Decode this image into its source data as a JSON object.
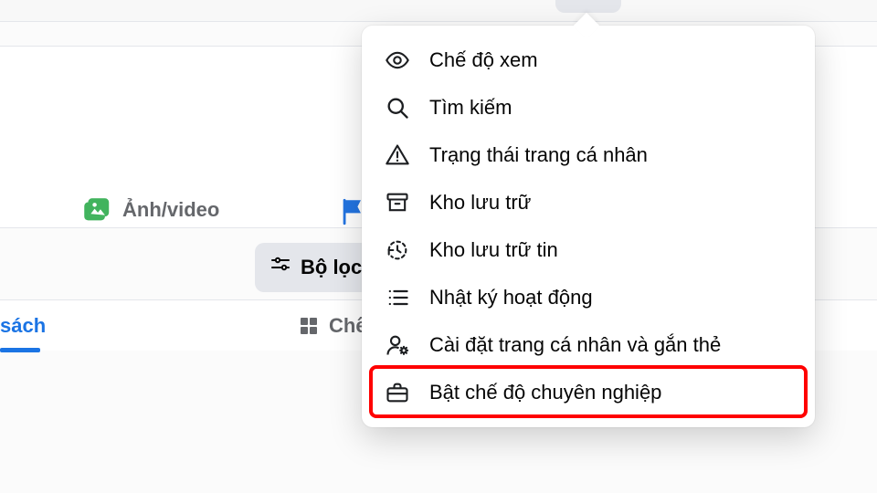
{
  "composer": {
    "photo_video_label": "Ảnh/video"
  },
  "filter": {
    "label": "Bộ lọc"
  },
  "tabs": {
    "list_label": "sách",
    "grid_label": "Chế đ"
  },
  "menu": {
    "items": [
      {
        "id": "view-mode",
        "label": "Chế độ xem"
      },
      {
        "id": "search",
        "label": "Tìm kiếm"
      },
      {
        "id": "profile-status",
        "label": "Trạng thái trang cá nhân"
      },
      {
        "id": "archive",
        "label": "Kho lưu trữ"
      },
      {
        "id": "story-archive",
        "label": "Kho lưu trữ tin"
      },
      {
        "id": "activity-log",
        "label": "Nhật ký hoạt động"
      },
      {
        "id": "profile-tagging",
        "label": "Cài đặt trang cá nhân và gắn thẻ"
      },
      {
        "id": "professional-mode",
        "label": "Bật chế độ chuyên nghiệp"
      }
    ]
  }
}
